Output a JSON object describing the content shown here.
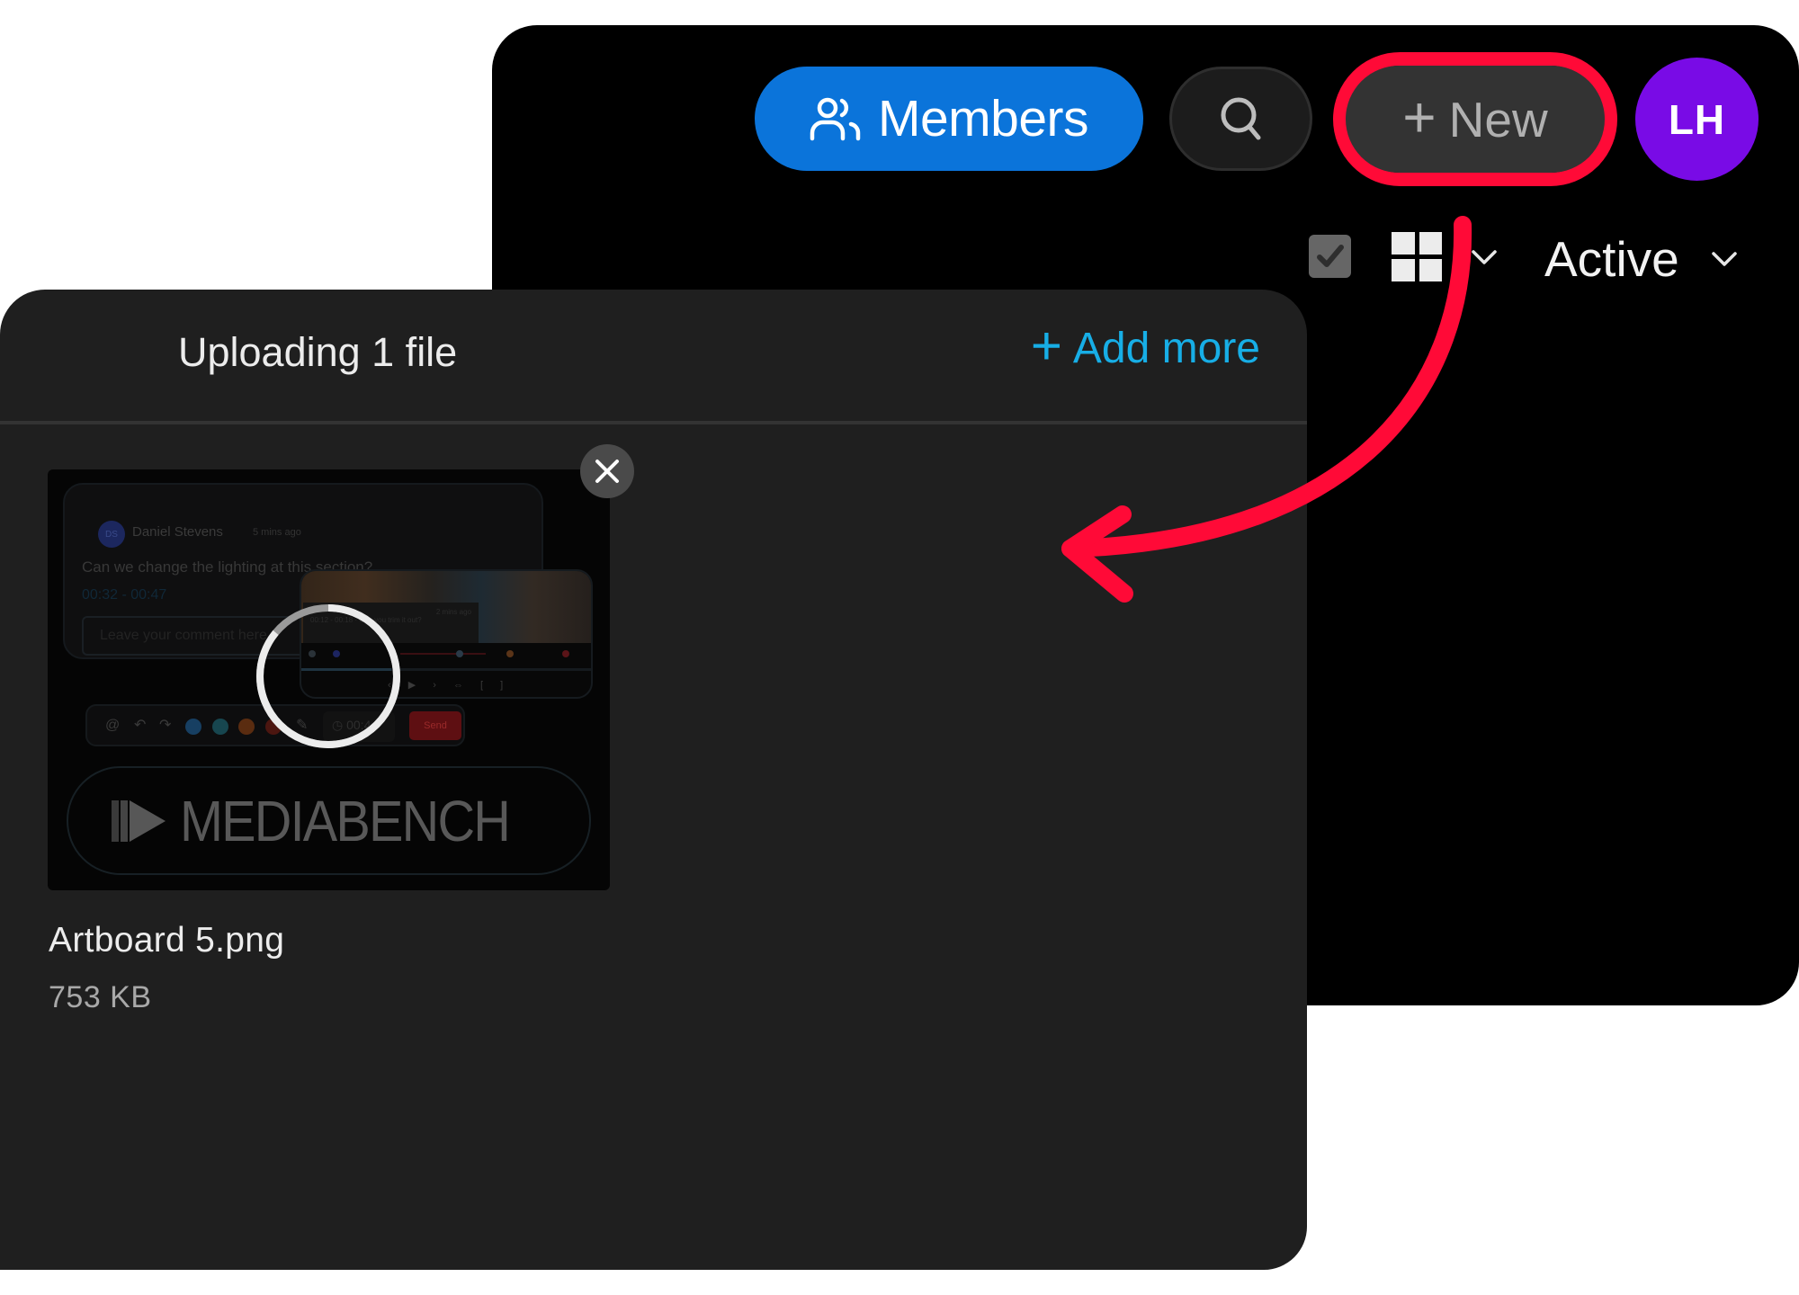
{
  "header": {
    "members_label": "Members",
    "new_label": "New",
    "avatar_initials": "LH",
    "filter_label": "Active",
    "icons": {
      "members": "people-icon",
      "search": "search-icon",
      "new": "plus-icon",
      "select": "checkbox-icon",
      "view": "grid-view-icon",
      "view_dropdown": "chevron-down-icon",
      "filter_dropdown": "chevron-down-icon"
    }
  },
  "colors": {
    "members_button": "#0b74da",
    "new_button": "#333333",
    "avatar": "#790be6",
    "highlight_annotation": "#ff0a37",
    "add_more_link": "#17aee6",
    "panel_background": "#1f1f1f",
    "window_background": "#000000"
  },
  "upload": {
    "title": "Uploading 1 file",
    "add_more_label": "Add more",
    "file": {
      "name": "Artboard 5.png",
      "size": "753 KB",
      "progress": 0.86
    },
    "thumbnail": {
      "comment_avatar": "DS",
      "comment_author": "Daniel Stevens",
      "comment_time": "5 mins ago",
      "comment_text": "Can we change the lighting at this section?",
      "comment_range": "00:32 - 00:47",
      "comment_placeholder": "Leave your comment here",
      "tooltip_text": "00:12 - 00:18 · Can you trim it out?",
      "tooltip_time": "2 mins ago",
      "controls": "‹ ▶ › ⇔ [ ]",
      "clock_text": "00:4",
      "send_label": "Send",
      "brand": "MEDIABENCH"
    }
  },
  "annotation": {
    "type": "curved-arrow",
    "from": "new-button",
    "to": "upload-panel"
  }
}
